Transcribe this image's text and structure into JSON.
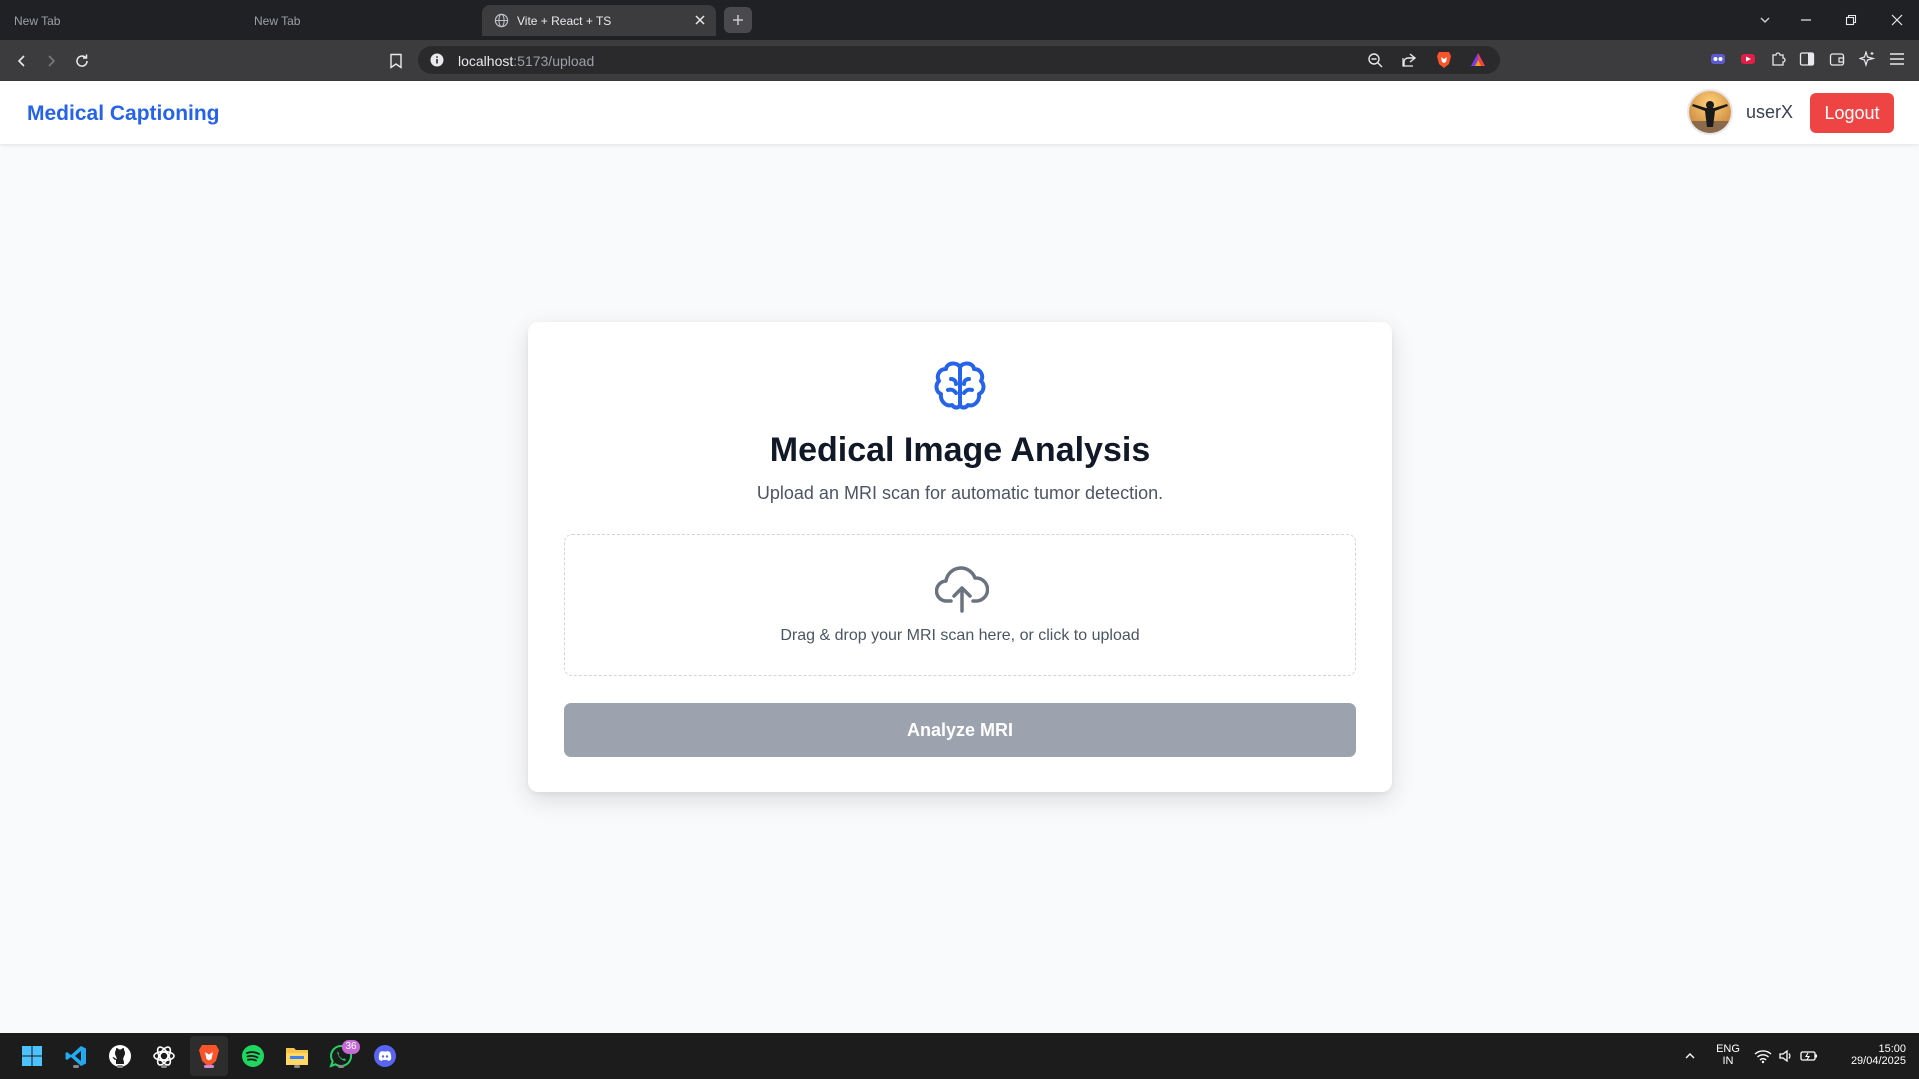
{
  "browser": {
    "tabs": [
      {
        "label": "New Tab",
        "active": false
      },
      {
        "label": "New Tab",
        "active": false
      },
      {
        "label": "Vite + React + TS",
        "active": true
      }
    ],
    "url_host": "localhost",
    "url_path": ":5173/upload"
  },
  "header": {
    "brand": "Medical Captioning",
    "username": "userX",
    "logout_label": "Logout"
  },
  "card": {
    "title": "Medical Image Analysis",
    "subtitle": "Upload an MRI scan for automatic tumor detection.",
    "dropzone_text": "Drag & drop your MRI scan here, or click to upload",
    "analyze_label": "Analyze MRI"
  },
  "taskbar": {
    "apps": [
      "windows-start",
      "vscode",
      "github",
      "chatgpt",
      "brave",
      "spotify",
      "file-explorer",
      "whatsapp",
      "discord"
    ],
    "whatsapp_badge": "36",
    "language_top": "ENG",
    "language_bottom": "IN",
    "time": "15:00",
    "date": "29/04/2025"
  },
  "colors": {
    "brand": "#2563eb",
    "logout": "#ef4444",
    "disabled_button": "#9ca3af"
  }
}
